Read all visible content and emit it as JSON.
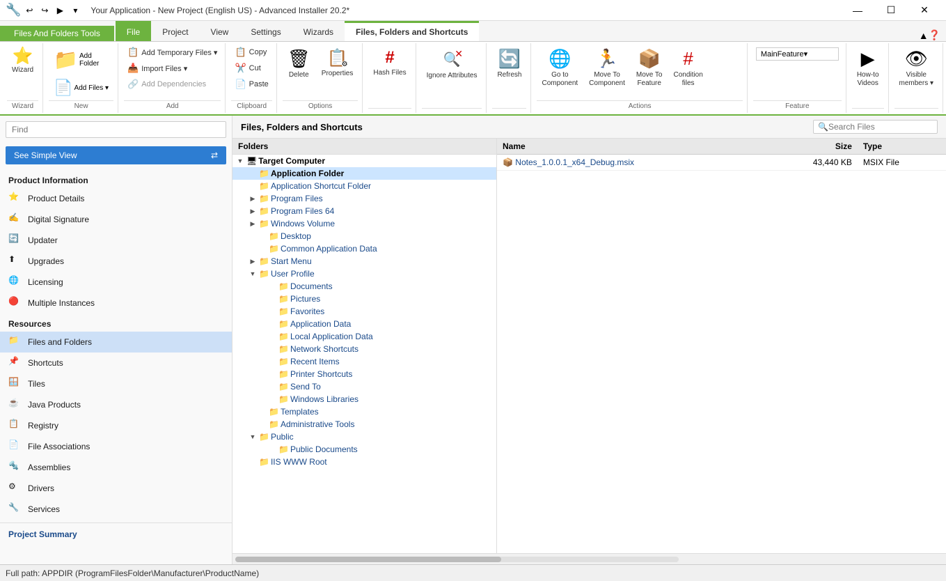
{
  "titleBar": {
    "appTitle": "Your Application - New Project (English US) - Advanced Installer 20.2*",
    "minLabel": "—",
    "maxLabel": "☐",
    "closeLabel": "✕"
  },
  "quickAccess": {
    "buttons": [
      "🔄",
      "↩",
      "↪",
      "▶"
    ]
  },
  "ribbonTabGroup": {
    "label": "Files And Folders Tools"
  },
  "ribbonTabs": [
    {
      "label": "File",
      "active": false,
      "highlight": true
    },
    {
      "label": "Project",
      "active": false
    },
    {
      "label": "View",
      "active": false
    },
    {
      "label": "Settings",
      "active": false
    },
    {
      "label": "Wizards",
      "active": false
    },
    {
      "label": "Files, Folders and Shortcuts",
      "active": true
    }
  ],
  "ribbon": {
    "sections": [
      {
        "name": "Wizard",
        "label": "Wizard",
        "buttons": [
          {
            "icon": "⭐",
            "label": "Wizard",
            "large": true
          }
        ]
      },
      {
        "name": "New",
        "label": "New",
        "rows": [
          {
            "icon": "📁",
            "label": "Add Folder",
            "hasDropdown": false
          },
          {
            "icon": "📄",
            "label": "Add Files",
            "hasDropdown": true
          }
        ]
      },
      {
        "name": "Add",
        "label": "Add",
        "rows": [
          {
            "icon": "📋",
            "label": "Add Temporary Files",
            "hasDropdown": true
          },
          {
            "icon": "📥",
            "label": "Import Files",
            "hasDropdown": true
          },
          {
            "icon": "🔗",
            "label": "Add Dependencies",
            "disabled": true
          }
        ]
      },
      {
        "name": "Clipboard",
        "label": "Clipboard",
        "rows": [
          {
            "icon": "📋",
            "label": "Copy"
          },
          {
            "icon": "✂️",
            "label": "Cut"
          },
          {
            "icon": "📄",
            "label": "Paste"
          }
        ]
      },
      {
        "name": "Options",
        "label": "Options",
        "buttons": [
          {
            "icon": "🗑",
            "label": "Delete",
            "large": true
          },
          {
            "icon": "⚙",
            "label": "Properties",
            "large": true
          }
        ]
      },
      {
        "name": "HashFiles",
        "label": "Hash Files"
      },
      {
        "name": "IgnoreAttributes",
        "label": "Ignore Attributes"
      },
      {
        "name": "Refresh",
        "label": "Refresh"
      },
      {
        "name": "GoToComponent",
        "label": "Go to Component"
      },
      {
        "name": "MoveToComponent",
        "label": "Move To Component"
      },
      {
        "name": "MoveToFeature",
        "label": "Move To Feature"
      },
      {
        "name": "ConditionFiles",
        "label": "Condition files"
      }
    ],
    "actionsSectionLabel": "Actions",
    "featureLabel": "MainFeature",
    "featureSectionLabel": "Feature",
    "howToVideosLabel": "How-to Videos",
    "visibleMembersLabel": "Visible members"
  },
  "contentArea": {
    "title": "Files, Folders and Shortcuts",
    "searchPlaceholder": "Search Files"
  },
  "foldersPane": {
    "header": "Folders",
    "tree": [
      {
        "id": "target",
        "label": "Target Computer",
        "level": 0,
        "expanded": true,
        "isRoot": true,
        "icon": "🖥"
      },
      {
        "id": "appfolder",
        "label": "Application Folder",
        "level": 1,
        "expanded": false,
        "selected": true,
        "icon": "📁"
      },
      {
        "id": "appshortcut",
        "label": "Application Shortcut Folder",
        "level": 1,
        "expanded": false,
        "icon": "📁"
      },
      {
        "id": "programfiles",
        "label": "Program Files",
        "level": 1,
        "expanded": false,
        "hasArrow": true,
        "icon": "📁"
      },
      {
        "id": "programfiles64",
        "label": "Program Files 64",
        "level": 1,
        "expanded": false,
        "hasArrow": true,
        "icon": "📁"
      },
      {
        "id": "windowsvolume",
        "label": "Windows Volume",
        "level": 1,
        "expanded": false,
        "hasArrow": true,
        "icon": "📁"
      },
      {
        "id": "desktop",
        "label": "Desktop",
        "level": 1,
        "icon": "📁"
      },
      {
        "id": "commonappdata",
        "label": "Common Application Data",
        "level": 1,
        "icon": "📁"
      },
      {
        "id": "startmenu",
        "label": "Start Menu",
        "level": 1,
        "hasArrow": true,
        "icon": "📁"
      },
      {
        "id": "userprofile",
        "label": "User Profile",
        "level": 1,
        "expanded": true,
        "hasArrow": true,
        "icon": "📁"
      },
      {
        "id": "documents",
        "label": "Documents",
        "level": 2,
        "icon": "📁"
      },
      {
        "id": "pictures",
        "label": "Pictures",
        "level": 2,
        "icon": "📁"
      },
      {
        "id": "favorites",
        "label": "Favorites",
        "level": 2,
        "icon": "📁"
      },
      {
        "id": "appdata",
        "label": "Application Data",
        "level": 2,
        "icon": "📁"
      },
      {
        "id": "localappdata",
        "label": "Local Application Data",
        "level": 2,
        "icon": "📁"
      },
      {
        "id": "networkshortcuts",
        "label": "Network Shortcuts",
        "level": 2,
        "icon": "📁"
      },
      {
        "id": "recentitems",
        "label": "Recent Items",
        "level": 2,
        "icon": "📁"
      },
      {
        "id": "printershortcuts",
        "label": "Printer Shortcuts",
        "level": 2,
        "icon": "📁"
      },
      {
        "id": "sendto",
        "label": "Send To",
        "level": 2,
        "icon": "📁"
      },
      {
        "id": "windowslibraries",
        "label": "Windows Libraries",
        "level": 2,
        "icon": "📁"
      },
      {
        "id": "templates",
        "label": "Templates",
        "level": 1,
        "icon": "📁"
      },
      {
        "id": "admintools",
        "label": "Administrative Tools",
        "level": 1,
        "icon": "📁"
      },
      {
        "id": "public",
        "label": "Public",
        "level": 1,
        "expanded": true,
        "hasArrow": true,
        "icon": "📁"
      },
      {
        "id": "publicdocs",
        "label": "Public Documents",
        "level": 2,
        "icon": "📁"
      },
      {
        "id": "iiswwwroot",
        "label": "IIS WWW Root",
        "level": 1,
        "icon": "📁"
      }
    ]
  },
  "filesPane": {
    "columns": [
      {
        "label": "Name",
        "width": "60%"
      },
      {
        "label": "Size",
        "width": "20%"
      },
      {
        "label": "Type",
        "width": "20%"
      }
    ],
    "files": [
      {
        "name": "Notes_1.0.0.1_x64_Debug.msix",
        "size": "43,440 KB",
        "type": "MSIX File",
        "icon": "📦"
      }
    ]
  },
  "sidebar": {
    "searchPlaceholder": "Find",
    "viewBtnLabel": "See Simple View",
    "sections": [
      {
        "title": "Product Information",
        "items": [
          {
            "label": "Product Details",
            "icon": "⭐"
          },
          {
            "label": "Digital Signature",
            "icon": "✍"
          },
          {
            "label": "Updater",
            "icon": "🔄"
          },
          {
            "label": "Upgrades",
            "icon": "⬆"
          },
          {
            "label": "Licensing",
            "icon": "🌐"
          },
          {
            "label": "Multiple Instances",
            "icon": "🔴"
          }
        ]
      },
      {
        "title": "Resources",
        "items": [
          {
            "label": "Files and Folders",
            "icon": "📁",
            "active": true
          },
          {
            "label": "Shortcuts",
            "icon": "📌"
          },
          {
            "label": "Tiles",
            "icon": "🪟"
          },
          {
            "label": "Java Products",
            "icon": "☕"
          },
          {
            "label": "Registry",
            "icon": "📋"
          },
          {
            "label": "File Associations",
            "icon": "📄"
          },
          {
            "label": "Assemblies",
            "icon": "🔩"
          },
          {
            "label": "Drivers",
            "icon": "⚙"
          },
          {
            "label": "Services",
            "icon": "🔧"
          }
        ]
      }
    ]
  },
  "statusBar": {
    "text": "Full path: APPDIR (ProgramFilesFolder\\Manufacturer\\ProductName)"
  }
}
